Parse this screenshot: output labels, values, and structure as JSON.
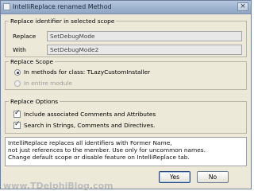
{
  "window": {
    "title": "IntelliReplace renamed Method"
  },
  "identifier_group": {
    "legend": "Replace identifier in selected scope",
    "replace_label": "Replace",
    "replace_value": "SetDebugMode",
    "with_label": "With",
    "with_value": "SetDebugMode2"
  },
  "scope_group": {
    "legend": "Replace Scope",
    "options": [
      {
        "label": "In methods for class: TLazyCustomInstaller",
        "selected": true,
        "enabled": true
      },
      {
        "label": "In entire module",
        "selected": false,
        "enabled": false
      }
    ]
  },
  "options_group": {
    "legend": "Replace Options",
    "options": [
      {
        "label": "Include associated Comments and Attributes",
        "checked": true
      },
      {
        "label": "Search in Strings, Comments and Directives.",
        "checked": true
      }
    ]
  },
  "info": {
    "lines": [
      "IntelliReplace replaces all identifiers with Former Name,",
      "not just references to the member. Use only for uncommon names.",
      "Change default scope or disable feature on IntelliReplace tab."
    ]
  },
  "buttons": {
    "yes": "Yes",
    "no": "No"
  },
  "watermark": "www.TDelphiBlog.com"
}
